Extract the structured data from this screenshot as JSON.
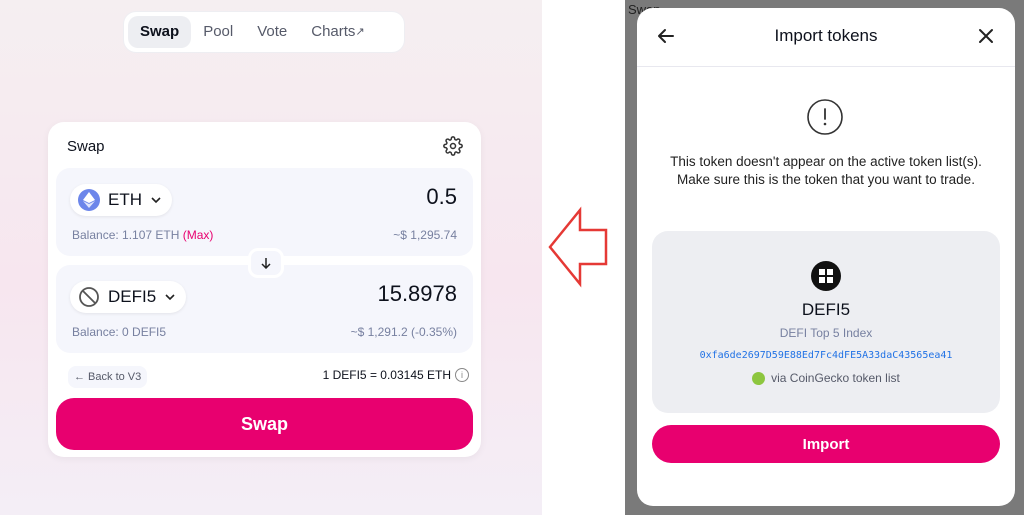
{
  "nav": {
    "items": [
      {
        "label": "Swap",
        "active": true
      },
      {
        "label": "Pool",
        "active": false
      },
      {
        "label": "Vote",
        "active": false
      },
      {
        "label": "Charts",
        "active": false,
        "external_mark": "↗"
      }
    ]
  },
  "swap": {
    "title": "Swap",
    "input": {
      "token": "ETH",
      "amount": "0.5",
      "balance_label": "Balance: 1.107 ETH",
      "max_label": "(Max)",
      "usd": "~$ 1,295.74"
    },
    "output": {
      "token": "DEFI5",
      "amount": "15.8978",
      "balance_label": "Balance: 0 DEFI5",
      "usd": "~$ 1,291.2 (-0.35%)"
    },
    "back_label": "← Back to V3",
    "rate": "1 DEFI5 = 0.03145 ETH",
    "button_label": "Swap"
  },
  "modal": {
    "behind_text": "Swap",
    "title": "Import tokens",
    "warning": "This token doesn't appear on the active token list(s). Make sure this is the token that you want to trade.",
    "token": {
      "symbol": "DEFI5",
      "name": "DEFI Top 5 Index",
      "address": "0xfa6de2697D59E88Ed7Fc4dFE5A33daC43565ea41",
      "source": "via CoinGecko token list"
    },
    "button_label": "Import"
  },
  "colors": {
    "accent": "#e8006f",
    "link": "#2172e5",
    "annotation_arrow": "#e53935"
  }
}
